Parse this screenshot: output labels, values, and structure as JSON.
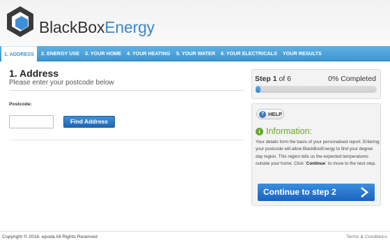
{
  "brand": {
    "part1": "BlackBox",
    "part2": "Energy"
  },
  "nav": [
    {
      "label": "1. ADDRESS",
      "active": true
    },
    {
      "label": "2. ENERGY USE"
    },
    {
      "label": "3. YOUR HOME"
    },
    {
      "label": "4. YOUR HEATING"
    },
    {
      "label": "5. YOUR WATER"
    },
    {
      "label": "6. YOUR ELECTRICALS"
    },
    {
      "label": "YOUR RESULTS"
    }
  ],
  "main": {
    "title": "1. Address",
    "subtitle": "Please enter your postcode below",
    "postcode_label": "Postcode:",
    "postcode_value": "",
    "find_button": "Find Address"
  },
  "progress": {
    "step_word": "Step",
    "step_current": "1",
    "step_of": "of 6",
    "completed_text": "0% Completed",
    "fraction": 0.0
  },
  "help": {
    "button_label": "HELP",
    "info_title": "Information:",
    "info_text_before": "Your details form the basis of your personalised report. Entering your postcode will allow BlackBoxEnergy to find your degree day region. This region tells us the expected temperatures outside your home. Click `",
    "info_text_bold": "Continue",
    "info_text_after": "` to move to the next step.",
    "continue_button": "Continue to step 2"
  },
  "footer": {
    "copyright": "Copyright © 2016. epoda All Rights Reserved",
    "terms": "Terms & Conditions"
  },
  "colors": {
    "accent": "#3d95d2",
    "info_green": "#6aa531",
    "logo_dark": "#3a3a3a"
  }
}
